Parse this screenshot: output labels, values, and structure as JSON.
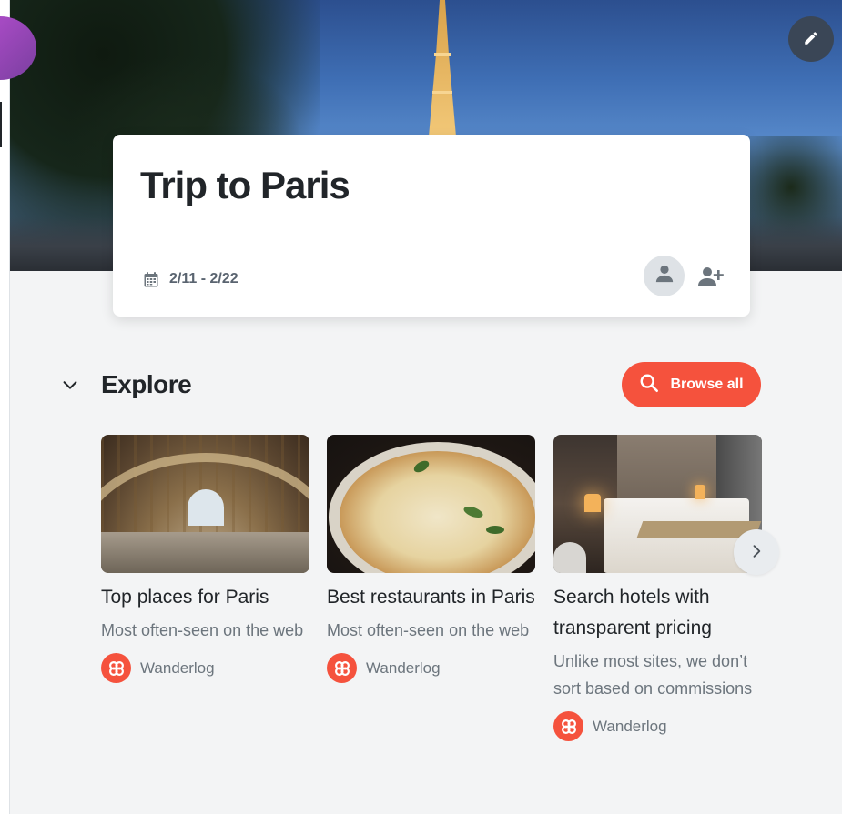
{
  "trip": {
    "title": "Trip to Paris",
    "dates": "2/11 - 2/22"
  },
  "explore": {
    "title": "Explore",
    "browse_label": "Browse all"
  },
  "cards": [
    {
      "title": "Top places for Paris",
      "description": "Most often-seen on the web",
      "source": "Wanderlog",
      "image": "musee-d-orsay-interior"
    },
    {
      "title": "Best restaurants in Paris",
      "description": "Most often-seen on the web",
      "source": "Wanderlog",
      "image": "pizza"
    },
    {
      "title": "Search hotels with transparent pricing",
      "description": "Unlike most sites, we don’t sort based on commissions",
      "source": "Wanderlog",
      "image": "hotel-room"
    }
  ],
  "icons": {
    "edit": "pencil-icon",
    "calendar": "calendar-icon",
    "user": "user-icon",
    "add_user": "user-plus-icon",
    "collapse": "chevron-down-icon",
    "search": "search-icon",
    "next": "chevron-right-icon",
    "brand_logo": "wanderlog-logo-icon"
  },
  "colors": {
    "accent": "#f5523d",
    "page_background": "#f3f4f5",
    "edit_button": "#3a4656",
    "muted_text": "#6c757d"
  }
}
